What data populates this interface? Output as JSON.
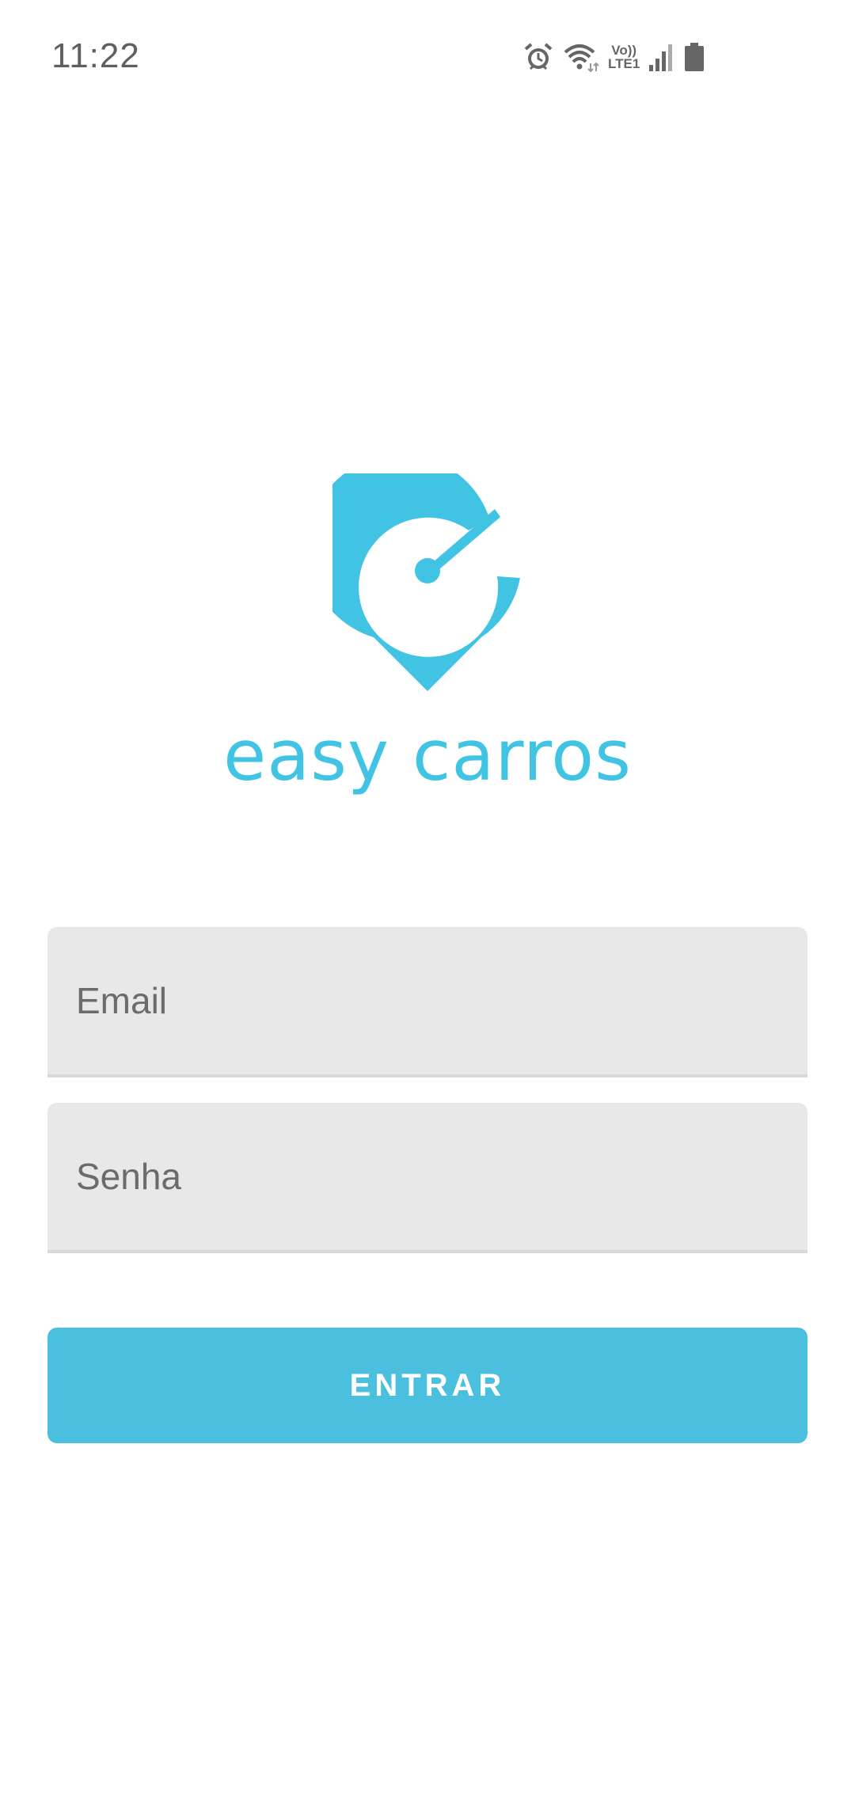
{
  "status_bar": {
    "time": "11:22",
    "icons": [
      "alarm-icon",
      "wifi-icon",
      "volte-icon",
      "signal-icon",
      "battery-icon"
    ],
    "volte_line1": "Vo))",
    "volte_line2": "LTE1"
  },
  "logo": {
    "brand_text": "easy carros",
    "brand_color": "#41c4e3",
    "icon": "speedometer-pin-icon"
  },
  "form": {
    "email_placeholder": "Email",
    "email_value": "",
    "password_placeholder": "Senha",
    "password_value": "",
    "submit_label": "ENTRAR",
    "button_color": "#4ac0de"
  }
}
